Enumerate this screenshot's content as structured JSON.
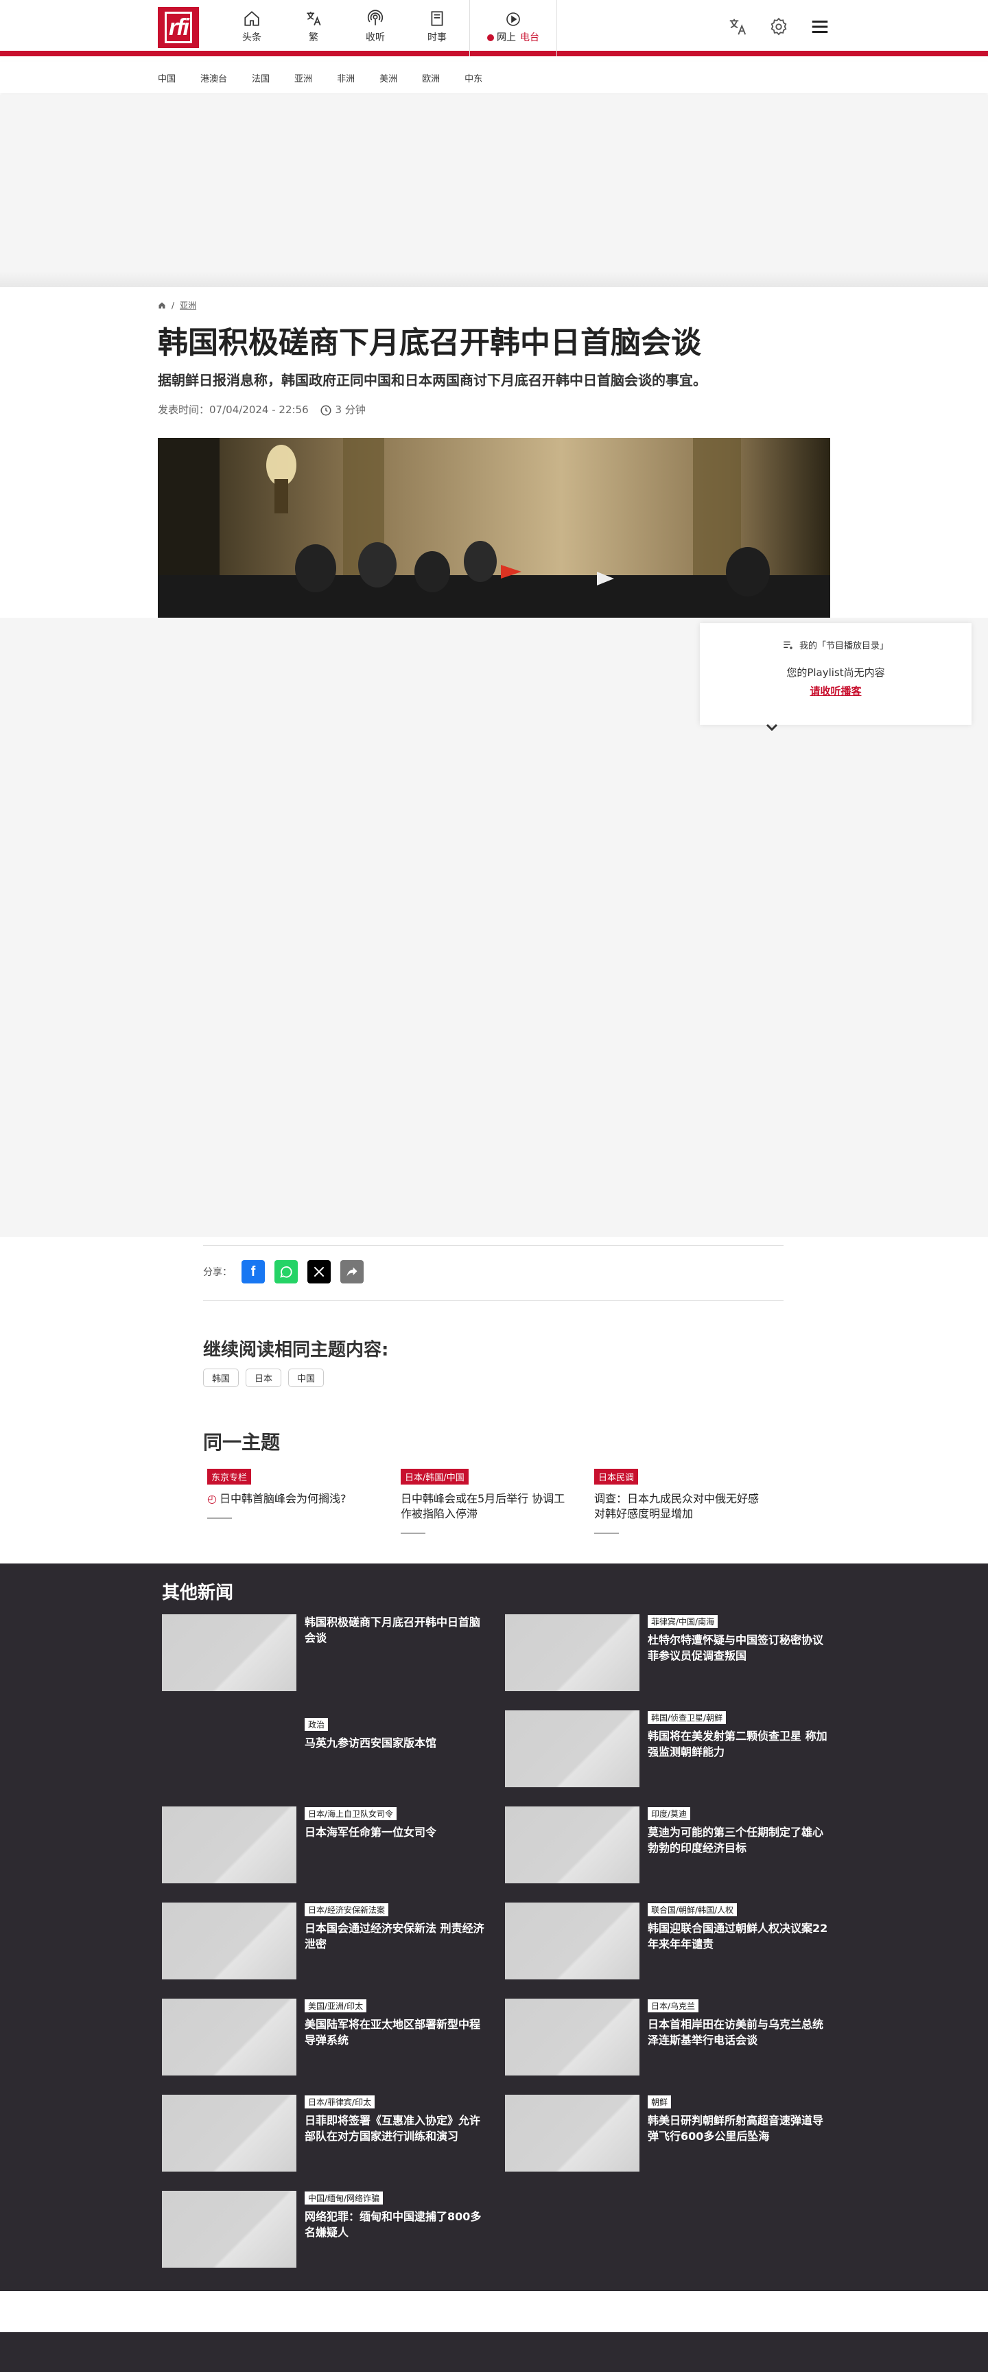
{
  "header": {
    "logo_text": "rfi",
    "nav": [
      {
        "label": "头条",
        "icon": "home-icon"
      },
      {
        "label": "繁",
        "icon": "translate-icon"
      },
      {
        "label": "收听",
        "icon": "podcast-icon"
      },
      {
        "label": "时事",
        "icon": "news-icon"
      }
    ],
    "radio": {
      "label": "网上",
      "live": "电台",
      "icon": "play-icon"
    }
  },
  "subnav": [
    "中国",
    "港澳台",
    "法国",
    "亚洲",
    "非洲",
    "美洲",
    "欧洲",
    "中东"
  ],
  "breadcrumb": {
    "section": "亚洲"
  },
  "article": {
    "title": "韩国积极磋商下月底召开韩中日首脑会谈",
    "lead": "据朝鲜日报消息称，韩国政府正同中国和日本两国商讨下月底召开韩中日首脑会谈的事宜。",
    "published_label": "发表时间：",
    "published": "07/04/2024 - 22:56",
    "read_time": "3 分钟"
  },
  "playlist": {
    "title": "我的「节目播放目录」",
    "empty": "您的Playlist尚无内容",
    "link": "请收听播客"
  },
  "share": {
    "label": "分享："
  },
  "related": {
    "heading": "继续阅读相同主题内容:",
    "tags": [
      "韩国",
      "日本",
      "中国"
    ]
  },
  "same_topic": {
    "heading": "同一主题",
    "items": [
      {
        "badge": "东京专栏",
        "title": "日中韩首脑峰会为何搁浅?",
        "audio": true
      },
      {
        "badge": "日本/韩国/中国",
        "title": "日中韩峰会或在5月后举行 协调工作被指陷入停滞",
        "audio": false
      },
      {
        "badge": "日本民调",
        "title": "调查：日本九成民众对中俄无好感  对韩好感度明显增加",
        "audio": false
      }
    ]
  },
  "other_news": {
    "heading": "其他新闻",
    "items": [
      {
        "badge": "",
        "title": "韩国积极磋商下月底召开韩中日首脑会谈",
        "thumb": true
      },
      {
        "badge": "菲律宾/中国/南海",
        "title": "杜特尔特遭怀疑与中国签订秘密协议 菲参议员促调查叛国",
        "thumb": true
      },
      {
        "badge": "政治",
        "title": "马英九参访西安国家版本馆",
        "thumb": false
      },
      {
        "badge": "韩国/侦查卫星/朝鲜",
        "title": "韩国将在美发射第二颗侦查卫星 称加强监测朝鲜能力",
        "thumb": true
      },
      {
        "badge": "日本/海上自卫队女司令",
        "title": "日本海军任命第一位女司令",
        "thumb": true
      },
      {
        "badge": "印度/莫迪",
        "title": "莫迪为可能的第三个任期制定了雄心勃勃的印度经济目标",
        "thumb": true
      },
      {
        "badge": "日本/经济安保新法案",
        "title": "日本国会通过经济安保新法 刑责经济泄密",
        "thumb": true
      },
      {
        "badge": "联合国/朝鲜/韩国/人权",
        "title": "韩国迎联合国通过朝鲜人权决议案22年来年年谴责",
        "thumb": true
      },
      {
        "badge": "美国/亚洲/印太",
        "title": "美国陆军将在亚太地区部署新型中程导弹系统",
        "thumb": true
      },
      {
        "badge": "日本/乌克兰",
        "title": "日本首相岸田在访美前与乌克兰总统泽连斯基举行电话会谈",
        "thumb": true
      },
      {
        "badge": "日本/菲律宾/印太",
        "title": "日菲即将签署《互惠准入协定》允许部队在对方国家进行训练和演习",
        "thumb": true
      },
      {
        "badge": "朝鲜",
        "title": "韩美日研判朝鲜所射高超音速弹道导弹飞行600多公里后坠海",
        "thumb": true
      },
      {
        "badge": "中国/缅甸/网络诈骗",
        "title": "网络犯罪：缅甸和中国逮捕了800多名嫌疑人",
        "thumb": true
      }
    ]
  }
}
